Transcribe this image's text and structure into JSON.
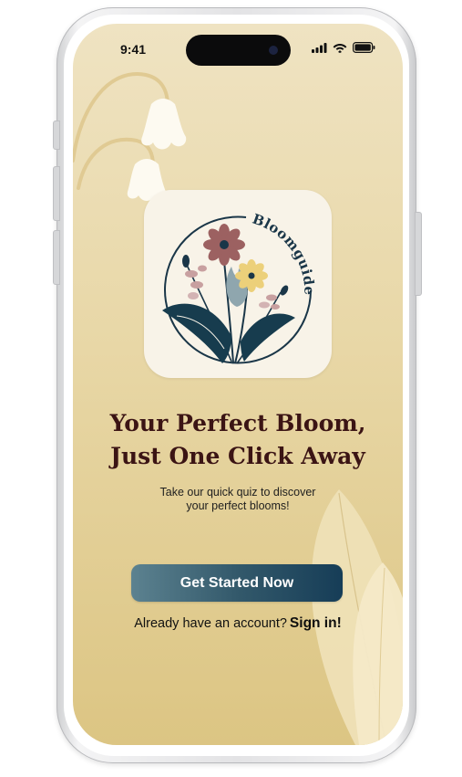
{
  "status_bar": {
    "time": "9:41",
    "icons": [
      "cellular-signal-icon",
      "wifi-icon",
      "battery-icon"
    ]
  },
  "app_icon": {
    "name": "Bloomguide",
    "icon": "bouquet-logo-icon"
  },
  "hero": {
    "headline_line1": "Your Perfect Bloom,",
    "headline_line2": "Just One Click Away",
    "subtext_line1": "Take our quick quiz to discover",
    "subtext_line2": "your perfect blooms!"
  },
  "actions": {
    "primary_label": "Get Started Now",
    "signin_prompt": "Already have an account?",
    "signin_link": "Sign in!"
  },
  "colors": {
    "background_top": "#efe3c2",
    "background_bottom": "#dcc583",
    "headline": "#3b1414",
    "button_start": "#5c8290",
    "button_end": "#163d57",
    "icon_tile": "#f8f3e8"
  }
}
